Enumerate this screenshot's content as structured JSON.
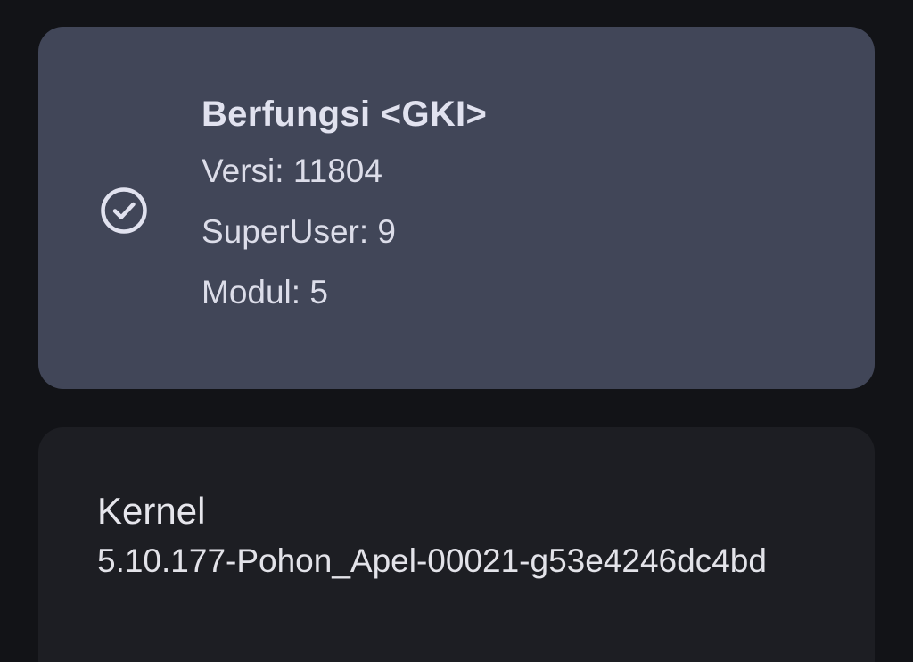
{
  "status_card": {
    "title": "Berfungsi <GKI>",
    "version": "Versi: 11804",
    "superuser": "SuperUser: 9",
    "modules": "Modul: 5",
    "icon": "check-circle-icon"
  },
  "info_card": {
    "kernel_label": "Kernel",
    "kernel_value": "5.10.177-Pohon_Apel-00021-g53e4246dc4bd"
  },
  "colors": {
    "background": "#121317",
    "status_card_bg": "#414658",
    "info_card_bg": "#1d1e23",
    "text_primary": "#e1e2ef"
  }
}
